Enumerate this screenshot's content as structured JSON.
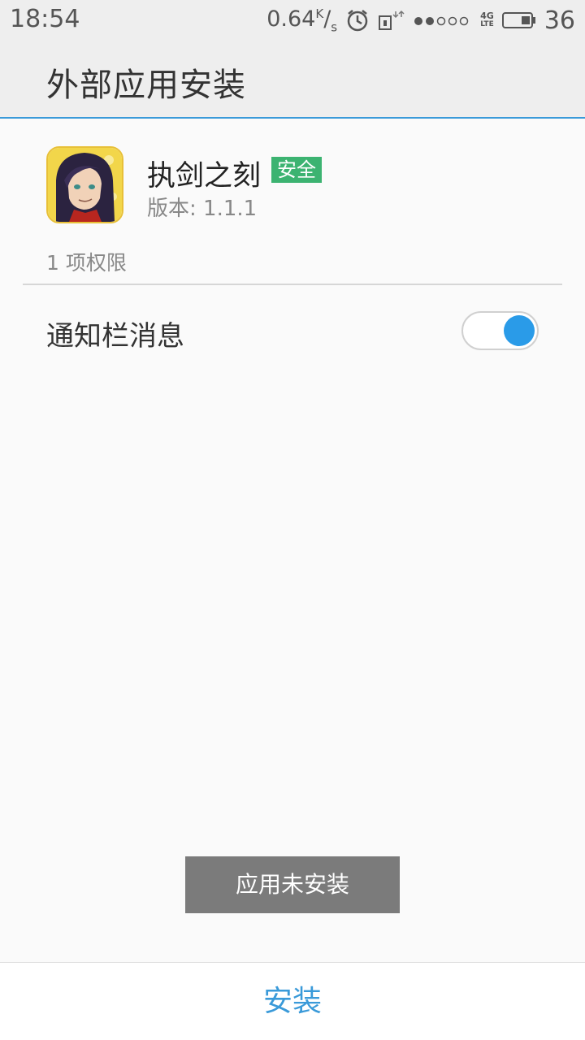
{
  "status_bar": {
    "time": "18:54",
    "net_speed_value": "0.64",
    "net_speed_unit_top": "K",
    "net_speed_unit_bottom": "s",
    "network_type_top": "4G",
    "network_type_bottom": "LTE",
    "battery_level": "36",
    "icons": [
      "alarm-icon",
      "sim-icon",
      "signal-icon",
      "battery-icon"
    ]
  },
  "header": {
    "title": "外部应用安装"
  },
  "app": {
    "name": "执剑之刻",
    "badge": "安全",
    "version_prefix": "版本: ",
    "version": "1.1.1",
    "icon": "app-icon"
  },
  "permissions": {
    "count_label": "1 项权限",
    "items": [
      {
        "label": "通知栏消息",
        "enabled": true
      }
    ]
  },
  "toast": {
    "message": "应用未安装"
  },
  "footer": {
    "install_label": "安装"
  },
  "colors": {
    "accent": "#3a9ad9",
    "safe_badge": "#3cb371",
    "toggle_on": "#2a9be8",
    "toast_bg": "#7b7b7b"
  }
}
